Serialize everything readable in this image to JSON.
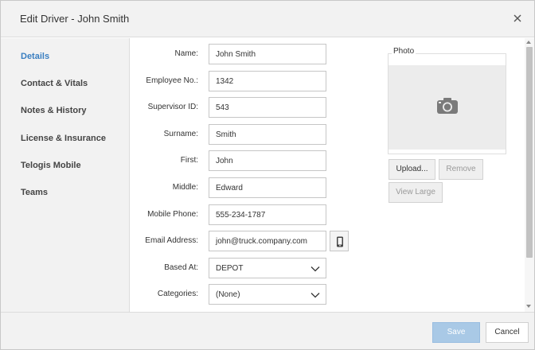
{
  "dialog": {
    "title": "Edit Driver - John Smith"
  },
  "sidebar": {
    "items": [
      {
        "label": "Details",
        "active": true
      },
      {
        "label": "Contact & Vitals",
        "active": false
      },
      {
        "label": "Notes & History",
        "active": false
      },
      {
        "label": "License & Insurance",
        "active": false
      },
      {
        "label": "Telogis Mobile",
        "active": false
      },
      {
        "label": "Teams",
        "active": false
      }
    ]
  },
  "form": {
    "name": {
      "label": "Name:",
      "value": "John Smith"
    },
    "employee_no": {
      "label": "Employee No.:",
      "value": "1342"
    },
    "supervisor_id": {
      "label": "Supervisor ID:",
      "value": "543"
    },
    "surname": {
      "label": "Surname:",
      "value": "Smith"
    },
    "first": {
      "label": "First:",
      "value": "John"
    },
    "middle": {
      "label": "Middle:",
      "value": "Edward"
    },
    "mobile_phone": {
      "label": "Mobile Phone:",
      "value": "555-234-1787"
    },
    "email": {
      "label": "Email Address:",
      "value": "john@truck.company.com"
    },
    "based_at": {
      "label": "Based At:",
      "value": "DEPOT"
    },
    "categories": {
      "label": "Categories:",
      "value": "(None)"
    }
  },
  "photo": {
    "legend": "Photo",
    "upload_label": "Upload...",
    "remove_label": "Remove",
    "view_large_label": "View Large"
  },
  "footer": {
    "save_label": "Save",
    "cancel_label": "Cancel"
  },
  "colors": {
    "accent": "#3a7fc1",
    "save_disabled": "#a9c9e6",
    "panel_bg": "#f2f2f2"
  },
  "icons": {
    "close": "close-icon",
    "camera": "camera-icon",
    "mobile": "mobile-phone-icon",
    "chevron": "chevron-down-icon"
  }
}
